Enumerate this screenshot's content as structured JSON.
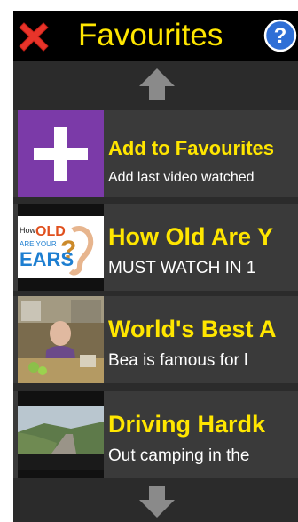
{
  "header": {
    "title": "Favourites",
    "close_icon": "red-x-icon",
    "help_icon": "question-mark-icon"
  },
  "items": [
    {
      "title": "Add to Favourites",
      "description": "Add last video watched",
      "thumb_icon": "plus-icon"
    },
    {
      "title": "How Old Are Y",
      "description": "MUST WATCH IN 1",
      "thumb_caption": "How OLD ARE YOUR EARS?"
    },
    {
      "title": "World's Best A",
      "description": "Bea is famous for l"
    },
    {
      "title": "Driving Hardk",
      "description": "Out camping in the"
    }
  ],
  "colors": {
    "accent": "#ffe600",
    "add_tile": "#7b3aa8",
    "background": "#2b2b2b",
    "header": "#000000"
  }
}
